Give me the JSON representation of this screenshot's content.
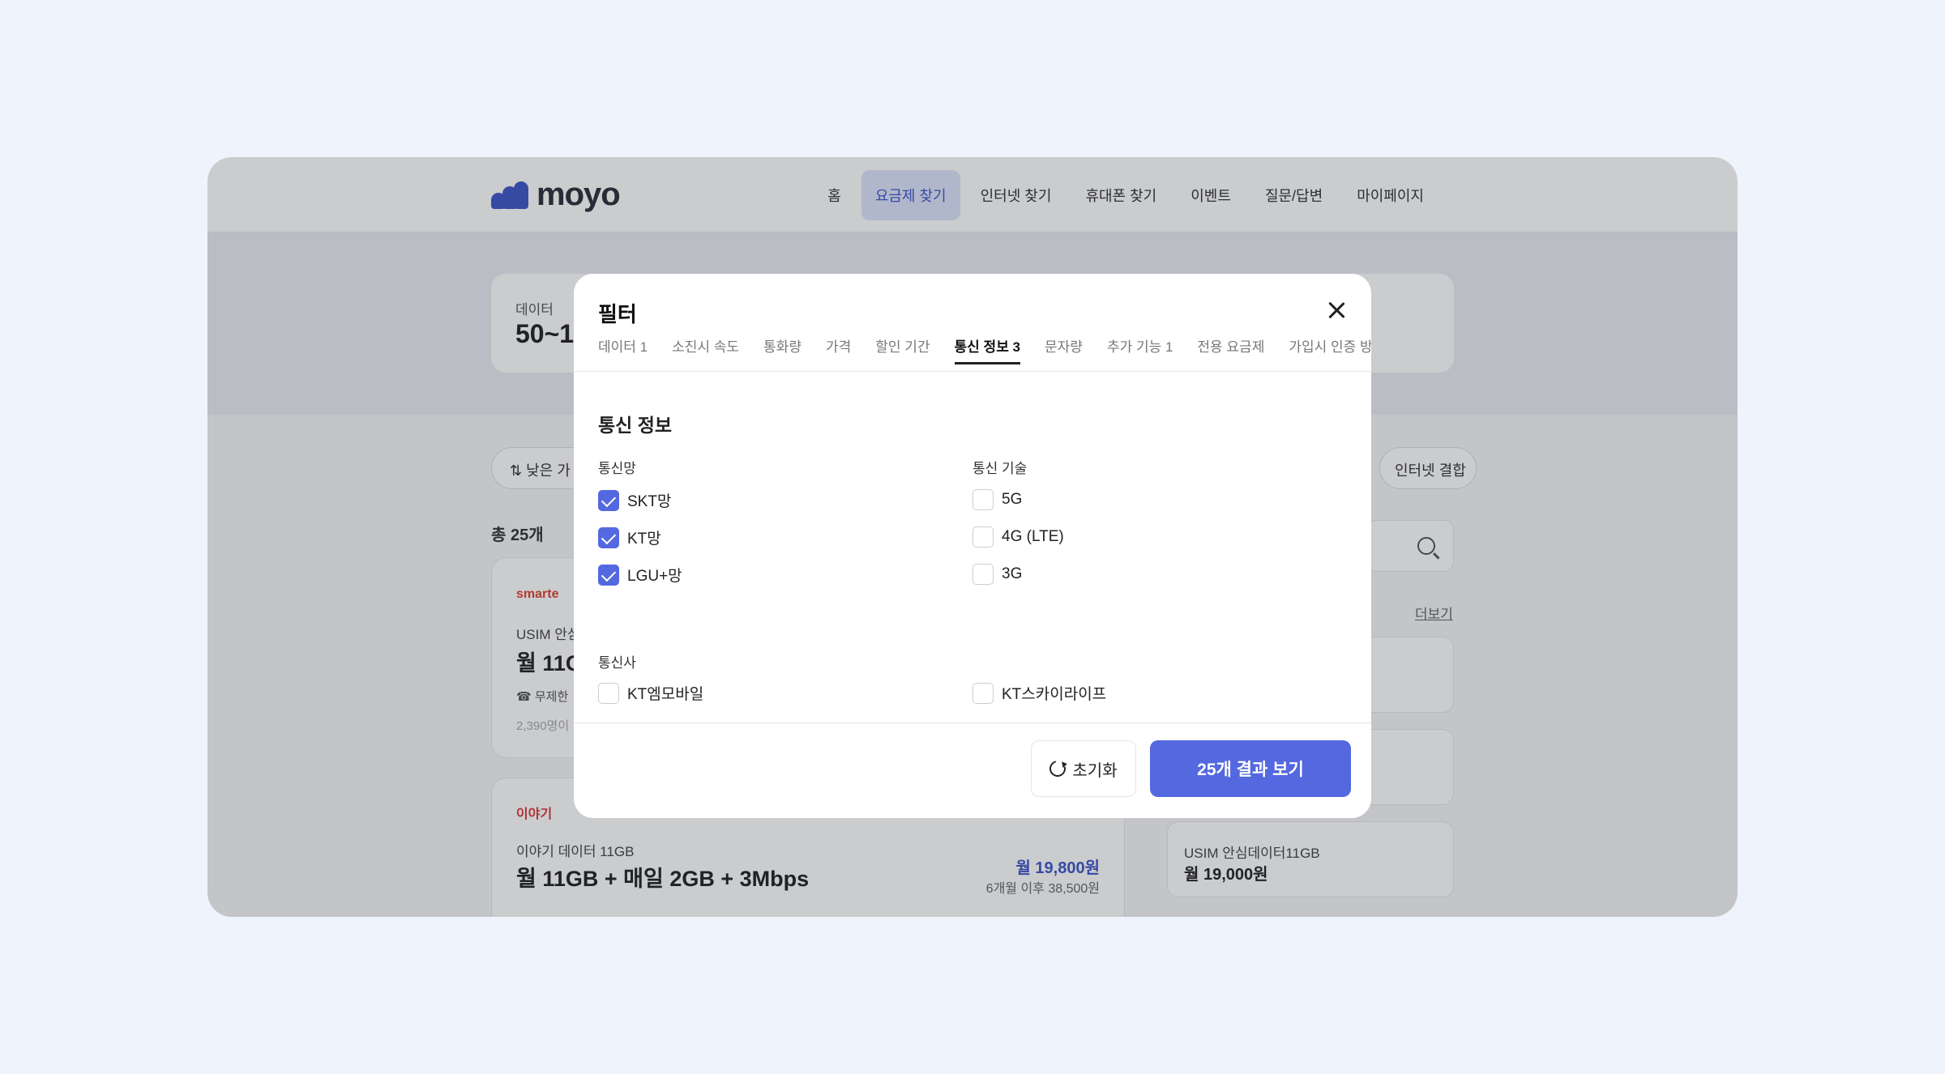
{
  "brand": {
    "name": "moyo"
  },
  "nav": {
    "items": [
      {
        "label": "홈"
      },
      {
        "label": "요금제 찾기"
      },
      {
        "label": "인터넷 찾기"
      },
      {
        "label": "휴대폰 찾기"
      },
      {
        "label": "이벤트"
      },
      {
        "label": "질문/답변"
      },
      {
        "label": "마이페이지"
      }
    ]
  },
  "hero": {
    "label": "데이터",
    "value": "50~1"
  },
  "toolbar": {
    "sort_label": "낮은 가",
    "right_pill": "인터넷 결합",
    "total": "총 25개",
    "more": "더보기"
  },
  "cards": [
    {
      "brand": "smarte",
      "sub": "USIM 안심",
      "plan": "월 11G",
      "feat": "무제한",
      "small": "2,390명이"
    },
    {
      "brand": "이야기",
      "sub": "이야기 데이터 11GB",
      "plan": "월 11GB + 매일 2GB + 3Mbps",
      "price": "월 19,800원",
      "price_sub": "6개월 이후 38,500원"
    }
  ],
  "side_card": {
    "title": "USIM 안심데이터11GB",
    "price": "월 19,000원"
  },
  "modal": {
    "title": "필터",
    "tabs": [
      {
        "label": "데이터 1"
      },
      {
        "label": "소진시 속도"
      },
      {
        "label": "통화량"
      },
      {
        "label": "가격"
      },
      {
        "label": "할인 기간"
      },
      {
        "label": "통신 정보 3"
      },
      {
        "label": "문자량"
      },
      {
        "label": "추가 기능 1"
      },
      {
        "label": "전용 요금제"
      },
      {
        "label": "가입시 인증 방법"
      }
    ],
    "section_title": "통신 정보",
    "network": {
      "label": "통신망",
      "options": [
        {
          "label": "SKT망",
          "checked": true
        },
        {
          "label": "KT망",
          "checked": true
        },
        {
          "label": "LGU+망",
          "checked": true
        }
      ]
    },
    "technology": {
      "label": "통신 기술",
      "options": [
        {
          "label": "5G",
          "checked": false
        },
        {
          "label": "4G (LTE)",
          "checked": false
        },
        {
          "label": "3G",
          "checked": false
        }
      ]
    },
    "carrier": {
      "label": "통신사",
      "options": [
        {
          "label": "KT엠모바일",
          "checked": false
        },
        {
          "label": "KT스카이라이프",
          "checked": false
        }
      ]
    },
    "reset_label": "초기화",
    "result_label": "25개 결과 보기"
  }
}
